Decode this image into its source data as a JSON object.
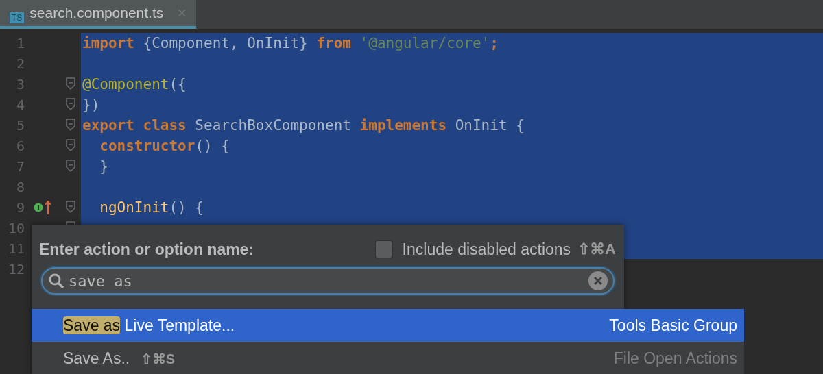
{
  "tabs": [
    {
      "label": "search.component.ts",
      "badge": "TS",
      "close": "×",
      "selected": true
    }
  ],
  "editor": {
    "lines": [
      {
        "number": "1",
        "selected": true,
        "tokens": [
          {
            "kind": "keyword",
            "text": "import"
          },
          {
            "kind": "plain",
            "text": " {Component, OnInit} "
          },
          {
            "kind": "keyword",
            "text": "from"
          },
          {
            "kind": "string",
            "text": " '@angular/core'"
          },
          {
            "kind": "keyword",
            "text": ";"
          }
        ]
      },
      {
        "number": "2",
        "selected": true
      },
      {
        "number": "3",
        "selected": true,
        "fold": true,
        "tokens": [
          {
            "kind": "annotation",
            "text": "@Component"
          },
          {
            "kind": "plain",
            "text": "({"
          }
        ]
      },
      {
        "number": "4",
        "selected": true,
        "fold": true,
        "tokens": [
          {
            "kind": "plain",
            "text": "})"
          }
        ]
      },
      {
        "number": "5",
        "selected": true,
        "fold": true,
        "tokens": [
          {
            "kind": "keyword",
            "text": "export class"
          },
          {
            "kind": "plain",
            "text": " SearchBoxComponent "
          },
          {
            "kind": "keyword",
            "text": "implements"
          },
          {
            "kind": "plain",
            "text": " OnInit {"
          }
        ]
      },
      {
        "number": "6",
        "selected": true,
        "fold": true,
        "tokens": [
          {
            "kind": "keyword",
            "text": "  constructor"
          },
          {
            "kind": "plain",
            "text": "() {"
          }
        ]
      },
      {
        "number": "7",
        "selected": true,
        "fold": true,
        "tokens": [
          {
            "kind": "plain",
            "text": "  }"
          }
        ]
      },
      {
        "number": "8",
        "selected": true
      },
      {
        "number": "9",
        "selected": true,
        "fold": true,
        "marker": true,
        "tokens": [
          {
            "kind": "method",
            "text": "  ngOnInit"
          },
          {
            "kind": "plain",
            "text": "() {"
          }
        ]
      },
      {
        "number": "10",
        "selected": true,
        "fold": true
      },
      {
        "number": "11",
        "selected": true
      },
      {
        "number": "12",
        "selected": false
      }
    ]
  },
  "popup": {
    "prompt": "Enter action or option name:",
    "include_disabled": {
      "label": "Include disabled actions",
      "shortcut": "⇧⌘A",
      "checked": false
    },
    "search": {
      "value": "save as"
    },
    "results": [
      {
        "match": "Save as",
        "rest": " Live Template...",
        "group": "Tools Basic Group",
        "selected": true
      },
      {
        "rest": "Save As..",
        "shortcut": "⇧⌘S",
        "group": "File Open Actions",
        "selected": false
      }
    ]
  }
}
